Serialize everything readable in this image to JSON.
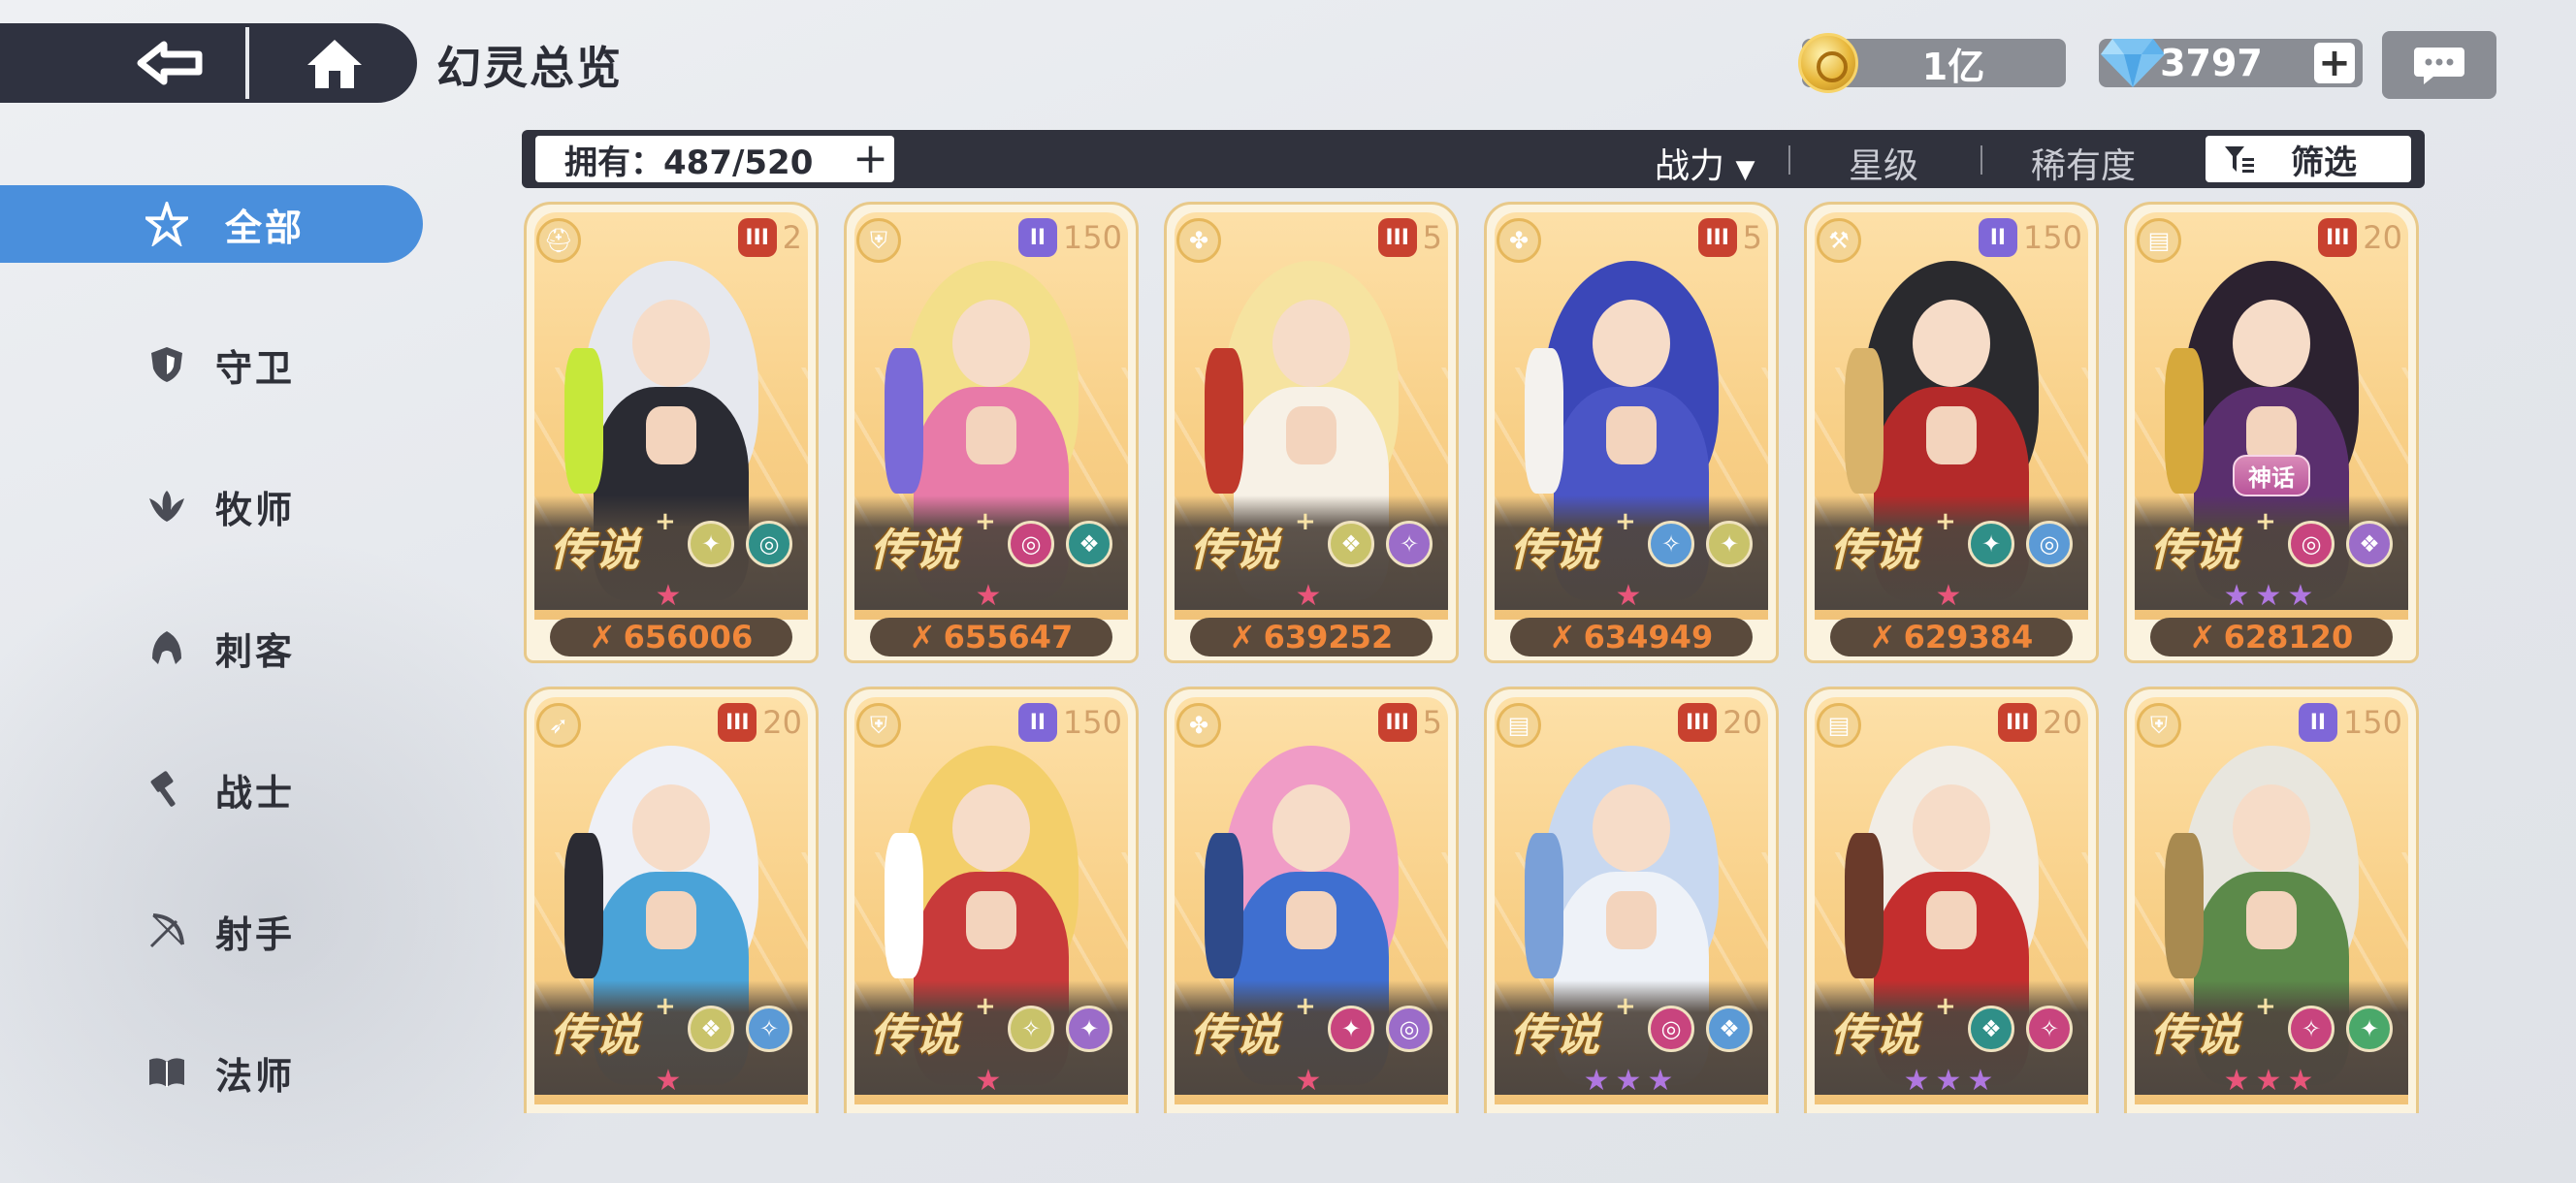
{
  "header": {
    "title": "幻灵总览",
    "gold": "1亿",
    "gems": "3797"
  },
  "sidebar": {
    "items": [
      {
        "label": "全部",
        "icon": "all-star-icon",
        "active": true
      },
      {
        "label": "守卫",
        "icon": "shield-icon",
        "active": false
      },
      {
        "label": "牧师",
        "icon": "wing-icon",
        "active": false
      },
      {
        "label": "刺客",
        "icon": "hood-icon",
        "active": false
      },
      {
        "label": "战士",
        "icon": "hammer-icon",
        "active": false
      },
      {
        "label": "射手",
        "icon": "bow-icon",
        "active": false
      },
      {
        "label": "法师",
        "icon": "book-icon",
        "active": false
      }
    ]
  },
  "toolbar": {
    "owned": "拥有：487/520",
    "sort_power": "战力",
    "sort_star": "星级",
    "sort_rarity": "稀有度",
    "filter": "筛选"
  },
  "cards": [
    {
      "rarity": "传说",
      "level": "2",
      "level_color": "red",
      "class": "hood-icon",
      "stars": "★",
      "star_color": "#e8557a",
      "power": "656006",
      "skills": [
        "#c9c36a",
        "#2f8f88"
      ],
      "myth": ""
    },
    {
      "rarity": "传说",
      "level": "150",
      "level_color": "purple",
      "class": "shield-icon",
      "stars": "★",
      "star_color": "#e8557a",
      "power": "655647",
      "skills": [
        "#c8447e",
        "#2f8f88"
      ],
      "myth": ""
    },
    {
      "rarity": "传说",
      "level": "5",
      "level_color": "red",
      "class": "wing-icon",
      "stars": "★",
      "star_color": "#e8557a",
      "power": "639252",
      "skills": [
        "#c9c36a",
        "#9b6cc9"
      ],
      "myth": ""
    },
    {
      "rarity": "传说",
      "level": "5",
      "level_color": "red",
      "class": "wing-icon",
      "stars": "★",
      "star_color": "#e8557a",
      "power": "634949",
      "skills": [
        "#5b9ad6",
        "#c9c36a"
      ],
      "myth": ""
    },
    {
      "rarity": "传说",
      "level": "150",
      "level_color": "purple",
      "class": "hammer-icon",
      "stars": "★",
      "star_color": "#e8557a",
      "power": "629384",
      "skills": [
        "#2f8f88",
        "#5b9ad6"
      ],
      "myth": ""
    },
    {
      "rarity": "传说",
      "level": "20",
      "level_color": "red",
      "class": "book-icon",
      "stars": "★★★",
      "star_color": "#b077e0",
      "power": "628120",
      "skills": [
        "#c8447e",
        "#9b6cc9"
      ],
      "myth": "神话"
    },
    {
      "rarity": "传说",
      "level": "20",
      "level_color": "red",
      "class": "bow-icon",
      "stars": "★",
      "star_color": "#e8557a",
      "power": "",
      "skills": [
        "#c9c36a",
        "#5b9ad6"
      ],
      "myth": ""
    },
    {
      "rarity": "传说",
      "level": "150",
      "level_color": "purple",
      "class": "shield-icon",
      "stars": "★",
      "star_color": "#e8557a",
      "power": "",
      "skills": [
        "#c9c36a",
        "#9b6cc9"
      ],
      "myth": ""
    },
    {
      "rarity": "传说",
      "level": "5",
      "level_color": "red",
      "class": "wing-icon",
      "stars": "★",
      "star_color": "#e8557a",
      "power": "",
      "skills": [
        "#c8447e",
        "#9b6cc9"
      ],
      "myth": ""
    },
    {
      "rarity": "传说",
      "level": "20",
      "level_color": "red",
      "class": "book-icon",
      "stars": "★★★",
      "star_color": "#b077e0",
      "power": "",
      "skills": [
        "#c8447e",
        "#5b9ad6"
      ],
      "myth": ""
    },
    {
      "rarity": "传说",
      "level": "20",
      "level_color": "red",
      "class": "book-icon",
      "stars": "★★★",
      "star_color": "#b077e0",
      "power": "",
      "skills": [
        "#2f8f88",
        "#c8447e"
      ],
      "myth": ""
    },
    {
      "rarity": "传说",
      "level": "150",
      "level_color": "purple",
      "class": "shield-icon",
      "stars": "★★★",
      "star_color": "#e8557a",
      "power": "",
      "skills": [
        "#c8447e",
        "#4aa86a"
      ],
      "myth": ""
    }
  ],
  "art": [
    {
      "hair": "#e6e8ee",
      "body": "#2a2b33",
      "acc": "#c6e83a"
    },
    {
      "hair": "#f3df8a",
      "body": "#e87aa8",
      "acc": "#7a6ad8"
    },
    {
      "hair": "#f6e3a0",
      "body": "#f7f1e6",
      "acc": "#c0392b"
    },
    {
      "hair": "#3b47b8",
      "body": "#4a55c6",
      "acc": "#f4f2ee"
    },
    {
      "hair": "#2a2a2e",
      "body": "#b42a2a",
      "acc": "#d9b36a"
    },
    {
      "hair": "#2c2230",
      "body": "#5a2f6e",
      "acc": "#d6a93c"
    },
    {
      "hair": "#eef0f6",
      "body": "#4aa3d8",
      "acc": "#2b2b33"
    },
    {
      "hair": "#f3cf6a",
      "body": "#c83a3a",
      "acc": "#ffffff"
    },
    {
      "hair": "#f09cc6",
      "body": "#3f6fd0",
      "acc": "#2e4a8a"
    },
    {
      "hair": "#c8d8f0",
      "body": "#eef2f8",
      "acc": "#7aa0d8"
    },
    {
      "hair": "#f1ede6",
      "body": "#c42e2e",
      "acc": "#6a3a2a"
    },
    {
      "hair": "#e8e6de",
      "body": "#5c8a4a",
      "acc": "#a88a50"
    }
  ]
}
